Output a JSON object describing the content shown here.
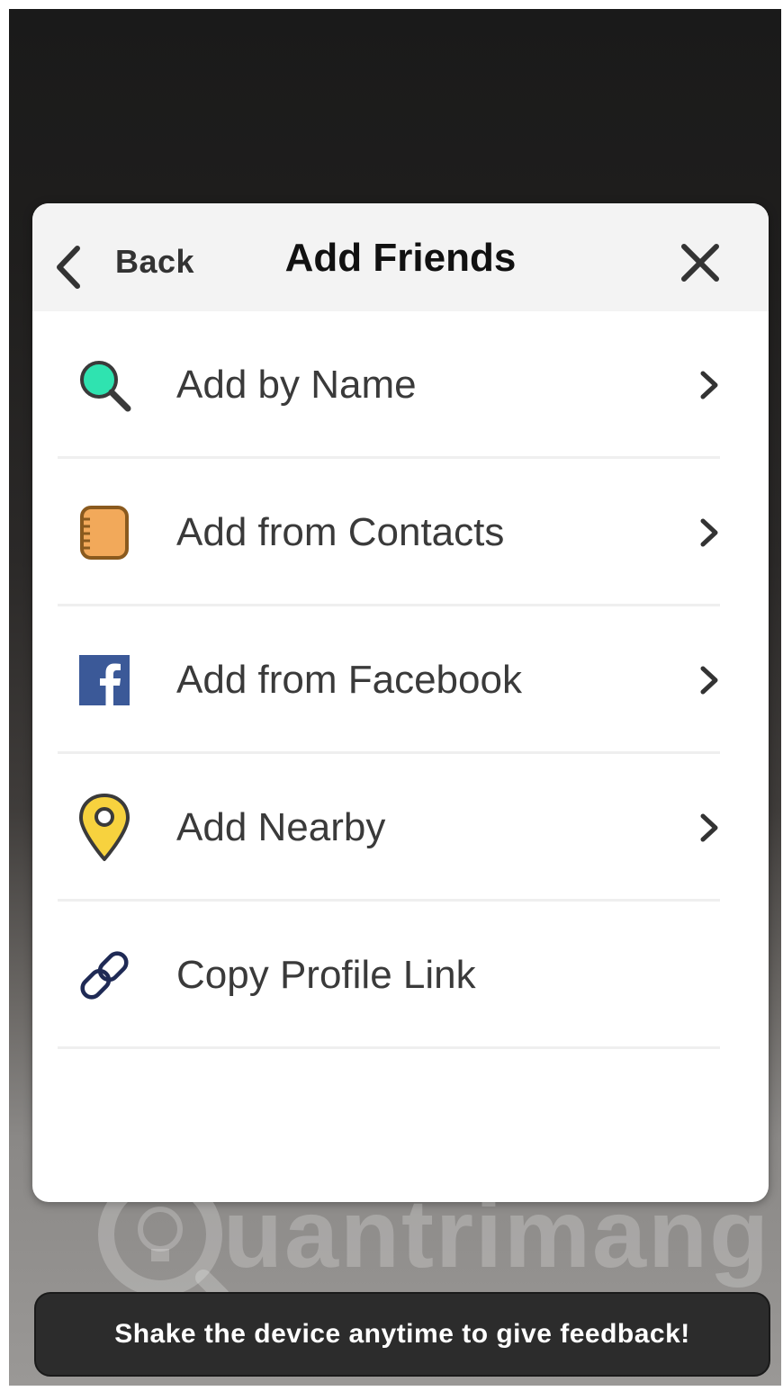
{
  "header": {
    "back_label": "Back",
    "title": "Add Friends"
  },
  "menu": {
    "items": [
      {
        "label": "Add by Name",
        "icon": "search-icon",
        "has_chevron": true
      },
      {
        "label": "Add from Contacts",
        "icon": "contacts-book-icon",
        "has_chevron": true
      },
      {
        "label": "Add from Facebook",
        "icon": "facebook-icon",
        "has_chevron": true
      },
      {
        "label": "Add Nearby",
        "icon": "location-pin-icon",
        "has_chevron": true
      },
      {
        "label": "Copy Profile Link",
        "icon": "link-icon",
        "has_chevron": false
      }
    ]
  },
  "toast": {
    "message": "Shake the device anytime to give feedback!"
  },
  "watermark": {
    "text": "uantrimang"
  },
  "colors": {
    "search_accent": "#2fe3b0",
    "contacts_accent": "#f2a95a",
    "facebook_blue": "#3b5998",
    "pin_yellow": "#f7d23e",
    "link_navy": "#1f2a55",
    "toast_bg": "#2c2c2c"
  }
}
